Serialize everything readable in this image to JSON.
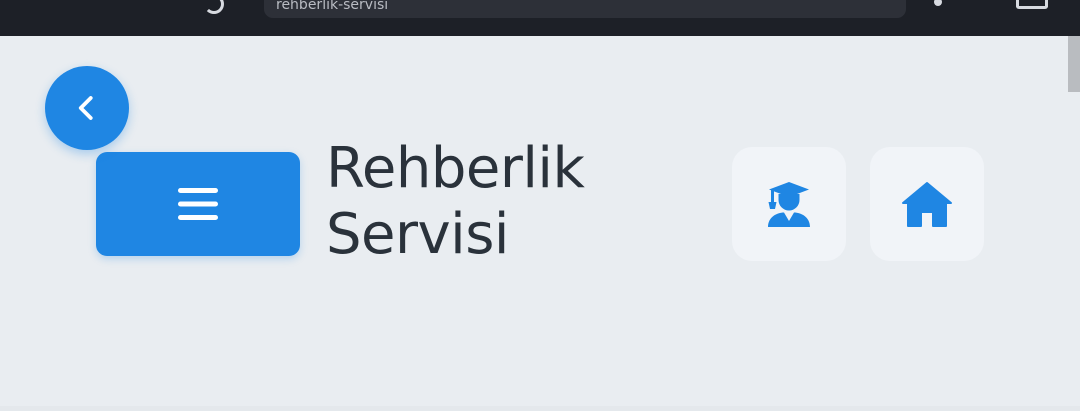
{
  "browser": {
    "address_text": "rehberlik-servisi"
  },
  "header": {
    "back_button": {
      "icon": "chevron-left-icon"
    },
    "menu_button": {
      "icon": "hamburger-menu-icon"
    },
    "title_line1": "Rehberlik",
    "title_line2": "Servisi",
    "action_buttons": [
      {
        "icon": "graduate-user-icon"
      },
      {
        "icon": "home-icon"
      }
    ]
  },
  "colors": {
    "accent": "#1f86e3",
    "background": "#e9edf1",
    "tile_background": "#f1f4f8",
    "title_text": "#2a323b",
    "browser_chrome": "#1d2027"
  }
}
